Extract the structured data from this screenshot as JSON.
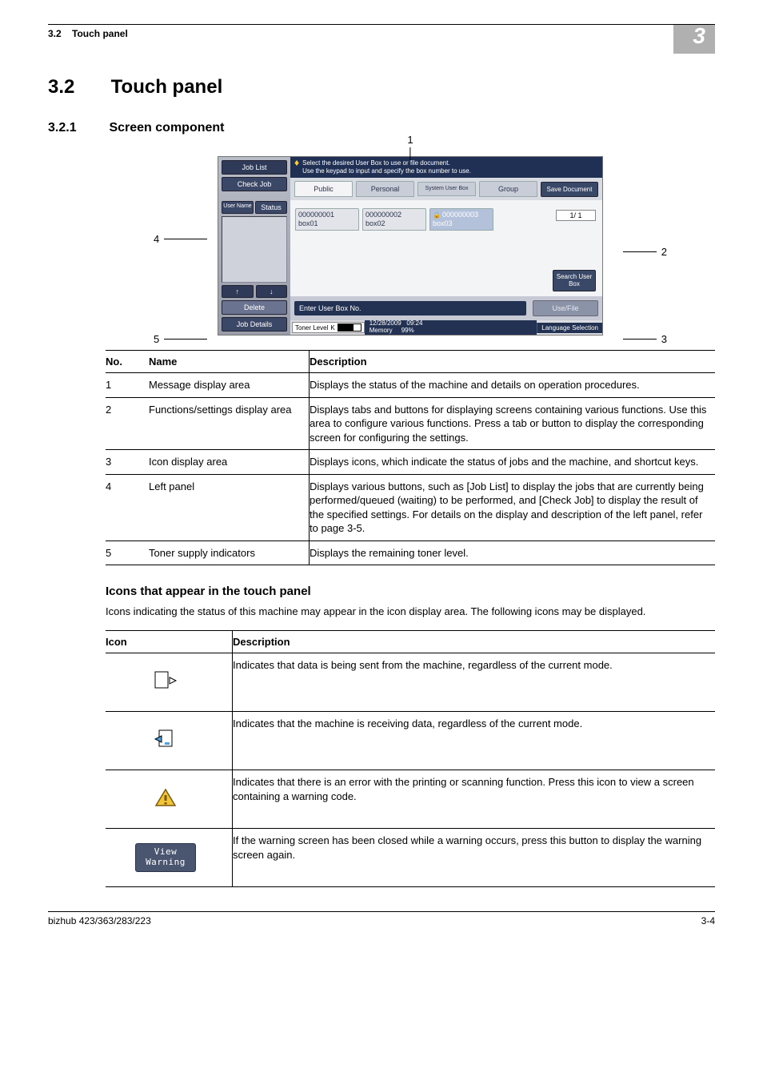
{
  "header": {
    "section_no": "3.2",
    "section_title": "Touch panel",
    "chapter_badge": "3"
  },
  "headings": {
    "h1_num": "3.2",
    "h1_title": "Touch panel",
    "h2_num": "3.2.1",
    "h2_title": "Screen component",
    "h3_icons": "Icons that appear in the touch panel"
  },
  "callouts": {
    "c1": "1",
    "c2": "2",
    "c3": "3",
    "c4": "4",
    "c5": "5"
  },
  "screenshot": {
    "left": {
      "job_list": "Job List",
      "check_job": "Check Job",
      "col_user": "User Name",
      "col_status": "Status",
      "arrow_up": "↑",
      "arrow_down": "↓",
      "delete": "Delete",
      "job_details": "Job Details"
    },
    "msg": {
      "line1": "Select the desired User Box to use or file document.",
      "line2": "Use the keypad to input and specify the box number to use."
    },
    "tabs": {
      "public": "Public",
      "personal": "Personal",
      "system": "System User Box",
      "group": "Group",
      "save": "Save Document"
    },
    "boxes": {
      "b1_no": "000000001",
      "b1_name": "box01",
      "b2_no": "000000002",
      "b2_name": "box02",
      "b3_no": "000000003",
      "b3_name": "box03",
      "page": "1/ 1",
      "search": "Search User Box"
    },
    "entry": {
      "label": "Enter User Box No.",
      "use": "Use/File"
    },
    "status": {
      "toner_label": "Toner Level",
      "toner_k": "K",
      "date": "12/28/2009",
      "time": "09:24",
      "memory": "Memory",
      "mem_pct": "99%",
      "lang": "Language Selection"
    }
  },
  "table1": {
    "head_no": "No.",
    "head_name": "Name",
    "head_desc": "Description",
    "rows": [
      {
        "no": "1",
        "name": "Message display area",
        "desc": "Displays the status of the machine and details on operation procedures."
      },
      {
        "no": "2",
        "name": "Functions/settings display area",
        "desc": "Displays tabs and buttons for displaying screens containing various functions. Use this area to configure various functions. Press a tab or button to display the corresponding screen for configuring the settings."
      },
      {
        "no": "3",
        "name": "Icon display area",
        "desc": "Displays icons, which indicate the status of jobs and the machine, and shortcut keys."
      },
      {
        "no": "4",
        "name": "Left panel",
        "desc": "Displays various buttons, such as [Job List] to display the jobs that are currently being performed/queued (waiting) to be performed, and [Check Job] to display the result of the specified settings. For details on the display and description of the left panel, refer to page 3-5."
      },
      {
        "no": "5",
        "name": "Toner supply indicators",
        "desc": "Displays the remaining toner level."
      }
    ]
  },
  "icons_intro": "Icons indicating the status of this machine may appear in the icon display area. The following icons may be displayed.",
  "table2": {
    "head_icon": "Icon",
    "head_desc": "Description",
    "rows": [
      {
        "icon": "data-out",
        "desc": "Indicates that data is being sent from the machine, regardless of the current mode."
      },
      {
        "icon": "data-in",
        "desc": "Indicates that the machine is receiving data, regardless of the current mode."
      },
      {
        "icon": "warning",
        "desc": "Indicates that there is an error with the printing or scanning function. Press this icon to view a screen containing a warning code."
      },
      {
        "icon": "view-warning",
        "label": "View Warning",
        "desc": "If the warning screen has been closed while a warning occurs, press this button to display the warning screen again."
      }
    ]
  },
  "footer": {
    "model": "bizhub 423/363/283/223",
    "page": "3-4"
  }
}
